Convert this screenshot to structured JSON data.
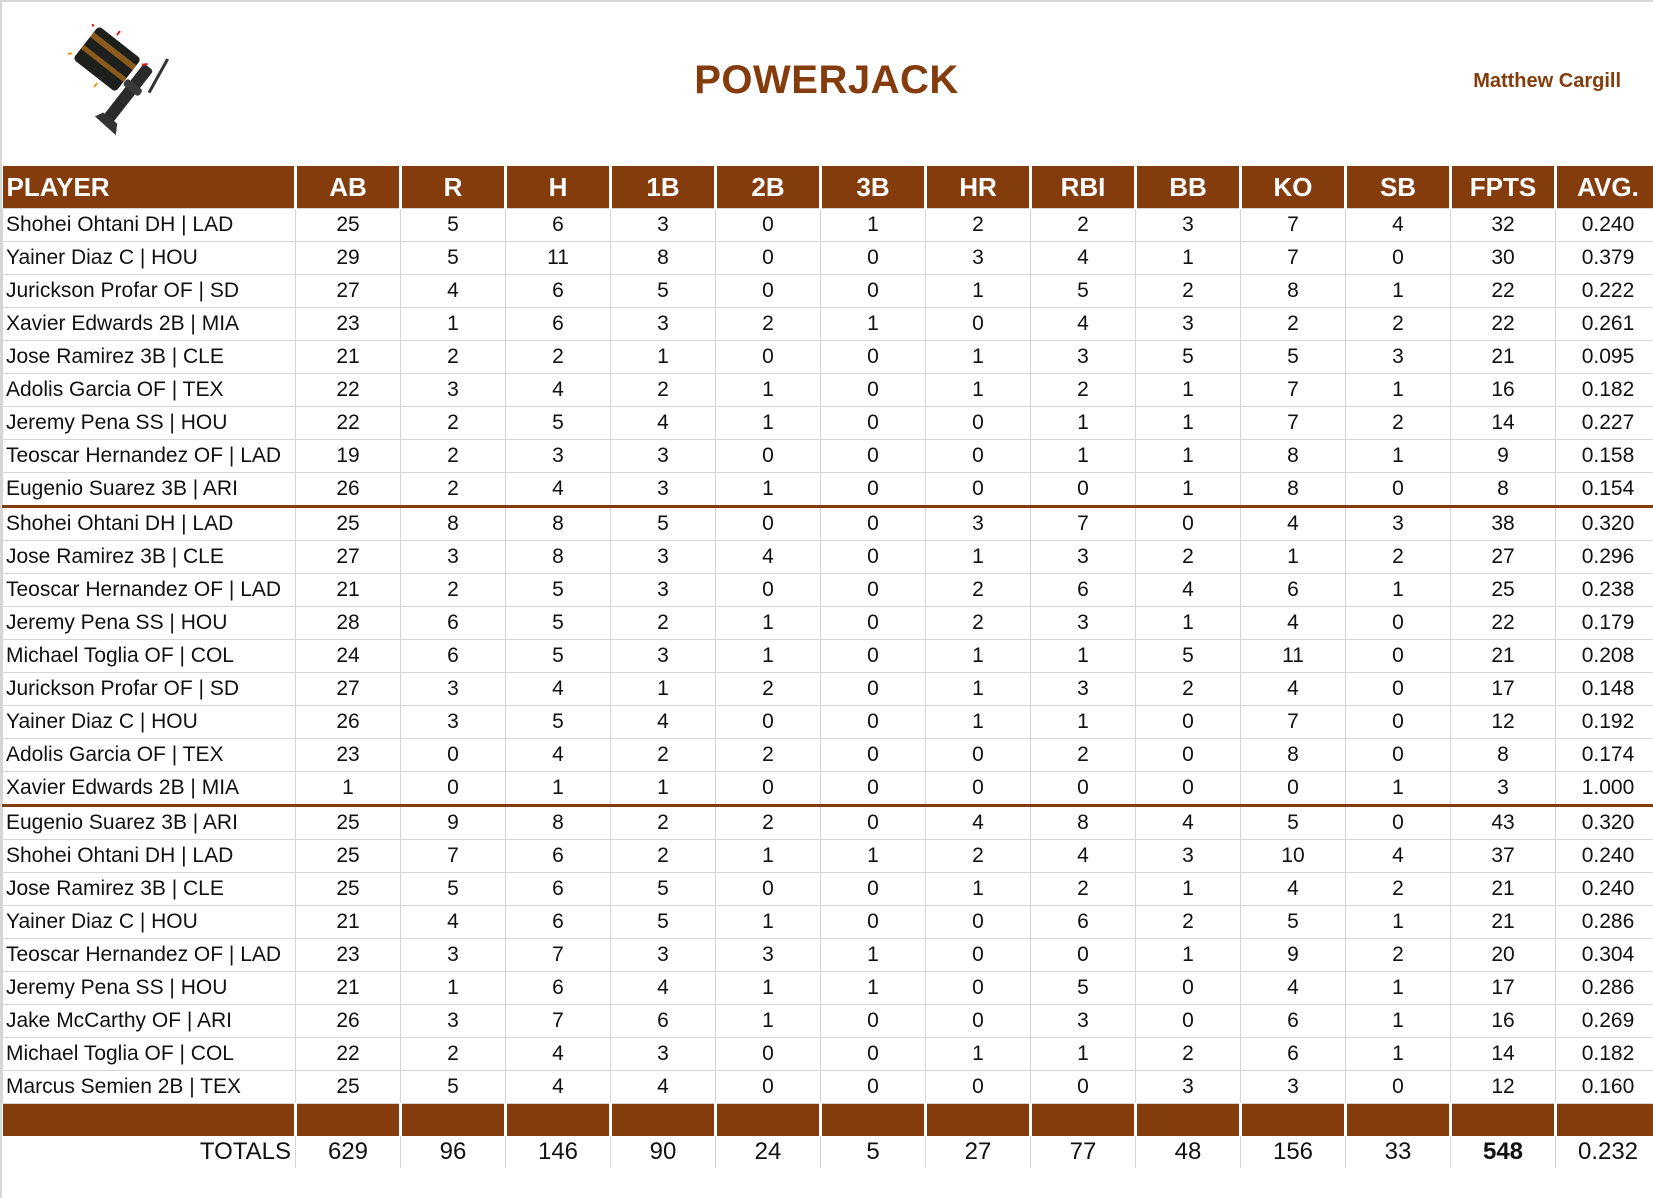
{
  "header": {
    "title": "POWERJACK",
    "owner": "Matthew Cargill",
    "logo_icon": "powerjack-hammer-icon",
    "accent_color": "#843C0C"
  },
  "table": {
    "columns": [
      "PLAYER",
      "AB",
      "R",
      "H",
      "1B",
      "2B",
      "3B",
      "HR",
      "RBI",
      "BB",
      "KO",
      "SB",
      "FPTS",
      "AVG."
    ],
    "groups": [
      {
        "rows": [
          {
            "player": "Shohei Ohtani DH | LAD",
            "stats": [
              "25",
              "5",
              "6",
              "3",
              "0",
              "1",
              "2",
              "2",
              "3",
              "7",
              "4",
              "32",
              "0.240"
            ]
          },
          {
            "player": "Yainer Diaz C | HOU",
            "stats": [
              "29",
              "5",
              "11",
              "8",
              "0",
              "0",
              "3",
              "4",
              "1",
              "7",
              "0",
              "30",
              "0.379"
            ]
          },
          {
            "player": "Jurickson Profar OF | SD",
            "stats": [
              "27",
              "4",
              "6",
              "5",
              "0",
              "0",
              "1",
              "5",
              "2",
              "8",
              "1",
              "22",
              "0.222"
            ]
          },
          {
            "player": "Xavier Edwards 2B | MIA",
            "stats": [
              "23",
              "1",
              "6",
              "3",
              "2",
              "1",
              "0",
              "4",
              "3",
              "2",
              "2",
              "22",
              "0.261"
            ]
          },
          {
            "player": "Jose Ramirez 3B | CLE",
            "stats": [
              "21",
              "2",
              "2",
              "1",
              "0",
              "0",
              "1",
              "3",
              "5",
              "5",
              "3",
              "21",
              "0.095"
            ]
          },
          {
            "player": "Adolis Garcia OF | TEX",
            "stats": [
              "22",
              "3",
              "4",
              "2",
              "1",
              "0",
              "1",
              "2",
              "1",
              "7",
              "1",
              "16",
              "0.182"
            ]
          },
          {
            "player": "Jeremy Pena SS | HOU",
            "stats": [
              "22",
              "2",
              "5",
              "4",
              "1",
              "0",
              "0",
              "1",
              "1",
              "7",
              "2",
              "14",
              "0.227"
            ]
          },
          {
            "player": "Teoscar Hernandez OF | LAD",
            "stats": [
              "19",
              "2",
              "3",
              "3",
              "0",
              "0",
              "0",
              "1",
              "1",
              "8",
              "1",
              "9",
              "0.158"
            ]
          },
          {
            "player": "Eugenio Suarez 3B | ARI",
            "stats": [
              "26",
              "2",
              "4",
              "3",
              "1",
              "0",
              "0",
              "0",
              "1",
              "8",
              "0",
              "8",
              "0.154"
            ]
          }
        ]
      },
      {
        "rows": [
          {
            "player": "Shohei Ohtani DH | LAD",
            "stats": [
              "25",
              "8",
              "8",
              "5",
              "0",
              "0",
              "3",
              "7",
              "0",
              "4",
              "3",
              "38",
              "0.320"
            ]
          },
          {
            "player": "Jose Ramirez 3B | CLE",
            "stats": [
              "27",
              "3",
              "8",
              "3",
              "4",
              "0",
              "1",
              "3",
              "2",
              "1",
              "2",
              "27",
              "0.296"
            ]
          },
          {
            "player": "Teoscar Hernandez OF | LAD",
            "stats": [
              "21",
              "2",
              "5",
              "3",
              "0",
              "0",
              "2",
              "6",
              "4",
              "6",
              "1",
              "25",
              "0.238"
            ]
          },
          {
            "player": "Jeremy Pena SS | HOU",
            "stats": [
              "28",
              "6",
              "5",
              "2",
              "1",
              "0",
              "2",
              "3",
              "1",
              "4",
              "0",
              "22",
              "0.179"
            ]
          },
          {
            "player": "Michael Toglia OF | COL",
            "stats": [
              "24",
              "6",
              "5",
              "3",
              "1",
              "0",
              "1",
              "1",
              "5",
              "11",
              "0",
              "21",
              "0.208"
            ]
          },
          {
            "player": "Jurickson Profar OF | SD",
            "stats": [
              "27",
              "3",
              "4",
              "1",
              "2",
              "0",
              "1",
              "3",
              "2",
              "4",
              "0",
              "17",
              "0.148"
            ]
          },
          {
            "player": "Yainer Diaz C | HOU",
            "stats": [
              "26",
              "3",
              "5",
              "4",
              "0",
              "0",
              "1",
              "1",
              "0",
              "7",
              "0",
              "12",
              "0.192"
            ]
          },
          {
            "player": "Adolis Garcia OF | TEX",
            "stats": [
              "23",
              "0",
              "4",
              "2",
              "2",
              "0",
              "0",
              "2",
              "0",
              "8",
              "0",
              "8",
              "0.174"
            ]
          },
          {
            "player": "Xavier Edwards 2B | MIA",
            "stats": [
              "1",
              "0",
              "1",
              "1",
              "0",
              "0",
              "0",
              "0",
              "0",
              "0",
              "1",
              "3",
              "1.000"
            ]
          }
        ]
      },
      {
        "rows": [
          {
            "player": "Eugenio Suarez 3B | ARI",
            "stats": [
              "25",
              "9",
              "8",
              "2",
              "2",
              "0",
              "4",
              "8",
              "4",
              "5",
              "0",
              "43",
              "0.320"
            ]
          },
          {
            "player": "Shohei Ohtani DH | LAD",
            "stats": [
              "25",
              "7",
              "6",
              "2",
              "1",
              "1",
              "2",
              "4",
              "3",
              "10",
              "4",
              "37",
              "0.240"
            ]
          },
          {
            "player": "Jose Ramirez 3B | CLE",
            "stats": [
              "25",
              "5",
              "6",
              "5",
              "0",
              "0",
              "1",
              "2",
              "1",
              "4",
              "2",
              "21",
              "0.240"
            ]
          },
          {
            "player": "Yainer Diaz C | HOU",
            "stats": [
              "21",
              "4",
              "6",
              "5",
              "1",
              "0",
              "0",
              "6",
              "2",
              "5",
              "1",
              "21",
              "0.286"
            ]
          },
          {
            "player": "Teoscar Hernandez OF | LAD",
            "stats": [
              "23",
              "3",
              "7",
              "3",
              "3",
              "1",
              "0",
              "0",
              "1",
              "9",
              "2",
              "20",
              "0.304"
            ]
          },
          {
            "player": "Jeremy Pena SS | HOU",
            "stats": [
              "21",
              "1",
              "6",
              "4",
              "1",
              "1",
              "0",
              "5",
              "0",
              "4",
              "1",
              "17",
              "0.286"
            ]
          },
          {
            "player": "Jake McCarthy OF | ARI",
            "stats": [
              "26",
              "3",
              "7",
              "6",
              "1",
              "0",
              "0",
              "3",
              "0",
              "6",
              "1",
              "16",
              "0.269"
            ]
          },
          {
            "player": "Michael Toglia OF | COL",
            "stats": [
              "22",
              "2",
              "4",
              "3",
              "0",
              "0",
              "1",
              "1",
              "2",
              "6",
              "1",
              "14",
              "0.182"
            ]
          },
          {
            "player": "Marcus Semien 2B | TEX",
            "stats": [
              "25",
              "5",
              "4",
              "4",
              "0",
              "0",
              "0",
              "0",
              "3",
              "3",
              "0",
              "12",
              "0.160"
            ]
          }
        ]
      }
    ],
    "totals": {
      "label": "TOTALS",
      "stats": [
        "629",
        "96",
        "146",
        "90",
        "24",
        "5",
        "27",
        "77",
        "48",
        "156",
        "33",
        "548",
        "0.232"
      ]
    }
  }
}
